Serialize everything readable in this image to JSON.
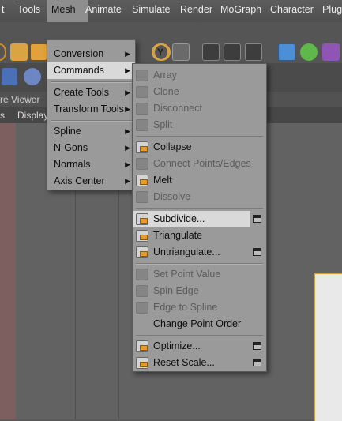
{
  "menubar": {
    "items": [
      "t",
      "Tools",
      "Mesh",
      "Animate",
      "Simulate",
      "Render",
      "MoGraph",
      "Character",
      "Plugi"
    ]
  },
  "viewer": {
    "header": "re Viewer",
    "sub": [
      "s",
      "Display"
    ]
  },
  "mesh_menu": {
    "items": [
      {
        "label": "Conversion",
        "submenu": true
      },
      {
        "label": "Commands",
        "submenu": true,
        "active": true
      },
      {
        "label": "Create Tools",
        "submenu": true
      },
      {
        "label": "Transform Tools",
        "submenu": true
      },
      {
        "label": "Spline",
        "submenu": true
      },
      {
        "label": "N-Gons",
        "submenu": true
      },
      {
        "label": "Normals",
        "submenu": true
      },
      {
        "label": "Axis Center",
        "submenu": true
      }
    ]
  },
  "commands_menu": {
    "items": [
      {
        "label": "Array",
        "enabled": false
      },
      {
        "label": "Clone",
        "enabled": false
      },
      {
        "label": "Disconnect",
        "enabled": false
      },
      {
        "label": "Split",
        "enabled": false
      },
      {
        "label": "Collapse",
        "enabled": true
      },
      {
        "label": "Connect Points/Edges",
        "enabled": false
      },
      {
        "label": "Melt",
        "enabled": true
      },
      {
        "label": "Dissolve",
        "enabled": false
      },
      {
        "label": "Subdivide...",
        "enabled": true,
        "highlighted": true,
        "options": true
      },
      {
        "label": "Triangulate",
        "enabled": true
      },
      {
        "label": "Untriangulate...",
        "enabled": true,
        "options": true
      },
      {
        "label": "Set Point Value",
        "enabled": false
      },
      {
        "label": "Spin Edge",
        "enabled": false
      },
      {
        "label": "Edge to Spline",
        "enabled": false
      },
      {
        "label": "Change Point Order",
        "enabled": true
      },
      {
        "label": "Optimize...",
        "enabled": true,
        "options": true
      },
      {
        "label": "Reset Scale...",
        "enabled": true,
        "options": true
      }
    ]
  },
  "colors": {
    "menubar": "#555555",
    "menu_bg": "#9a9a9a",
    "highlight": "#d9d9d9",
    "accent_orange": "#e69a2e"
  }
}
